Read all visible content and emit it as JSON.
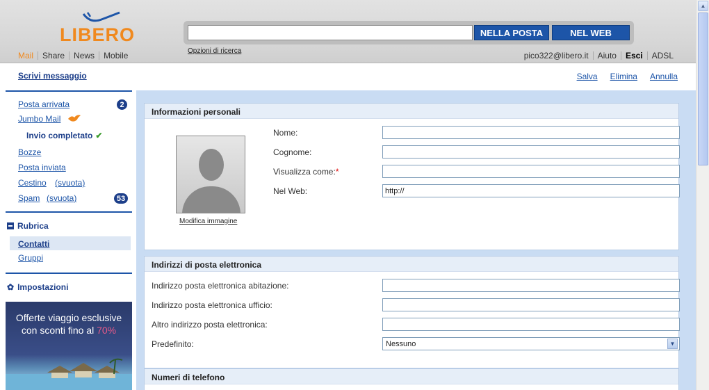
{
  "brand": {
    "logo_text": "LIBERO",
    "accent": "#f0891e",
    "primary": "#1d55a8"
  },
  "search": {
    "value": "",
    "button_posta": "NELLA POSTA",
    "button_web": "NEL WEB",
    "options_link": "Opzioni di ricerca"
  },
  "nav": [
    "Mail",
    "Share",
    "News",
    "Mobile"
  ],
  "user_nav": {
    "email": "pico322@libero.it",
    "help": "Aiuto",
    "logout": "Esci",
    "adsl": "ADSL"
  },
  "toolbar": {
    "compose": "Scrivi messaggio",
    "save": "Salva",
    "delete": "Elimina",
    "cancel": "Annulla"
  },
  "sidebar": {
    "inbox": "Posta arrivata",
    "inbox_count": "2",
    "jumbo": "Jumbo Mail",
    "sent_status": "Invio completato",
    "drafts": "Bozze",
    "sent": "Posta inviata",
    "trash": "Cestino",
    "trash_empty": "(svuota)",
    "spam": "Spam",
    "spam_empty": "(svuota)",
    "spam_count": "53",
    "addressbook": "Rubrica",
    "contacts": "Contatti",
    "groups": "Gruppi",
    "settings": "Impostazioni",
    "ad_line1": "Offerte viaggio esclusive",
    "ad_line2": "con sconti fino al",
    "ad_highlight": "70%"
  },
  "personal": {
    "title": "Informazioni personali",
    "first_name": "Nome:",
    "last_name": "Cognome:",
    "display_as": "Visualizza come:",
    "required_mark": "*",
    "web": "Nel Web:",
    "web_value": "http://",
    "edit_photo": "Modifica immagine"
  },
  "emails": {
    "title": "Indirizzi di posta elettronica",
    "home": "Indirizzo posta elettronica abitazione:",
    "work": "Indirizzo posta elettronica ufficio:",
    "other": "Altro indirizzo posta elettronica:",
    "default": "Predefinito:",
    "default_value": "Nessuno"
  },
  "phones": {
    "title": "Numeri di telefono"
  }
}
